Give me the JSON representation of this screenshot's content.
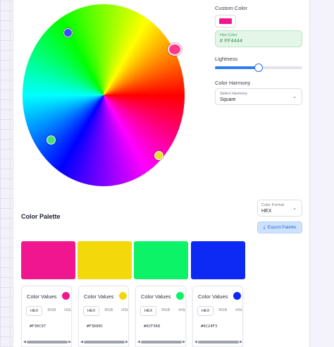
{
  "controls": {
    "custom_color_label": "Custom Color",
    "custom_swatch_color": "#f0168f",
    "hex_label": "Hex Color",
    "hex_value": "# FF4444",
    "lightness_label": "Lightness",
    "lightness_value": 0.5,
    "harmony_label": "Color Harmony",
    "harmony_select_label": "Select Harmony",
    "harmony_value": "Square"
  },
  "palette": {
    "title": "Color Palette",
    "format_label": "Color Format",
    "format_value": "HEX",
    "export_label": "Export Palette",
    "colors": [
      "#f0168f",
      "#f3d80c",
      "#0cf368",
      "#0c2af3"
    ]
  },
  "cards": [
    {
      "title": "Color Values",
      "color": "#f0168f",
      "code": "#F30C97",
      "tabs": [
        "HEX",
        "RGB",
        "HSL"
      ],
      "active_tab": "HEX"
    },
    {
      "title": "Color Values",
      "color": "#f3d80c",
      "code": "#F3D80C",
      "tabs": [
        "HEX",
        "RGB",
        "HSL"
      ],
      "active_tab": "HEX"
    },
    {
      "title": "Color Values",
      "color": "#0cf368",
      "code": "#0CF368",
      "tabs": [
        "HEX",
        "RGB",
        "HSL"
      ],
      "active_tab": "HEX"
    },
    {
      "title": "Color Values",
      "color": "#0c2af3",
      "code": "#0C24F3",
      "tabs": [
        "HEX",
        "RGB",
        "HSL"
      ],
      "active_tab": "HEX"
    }
  ]
}
